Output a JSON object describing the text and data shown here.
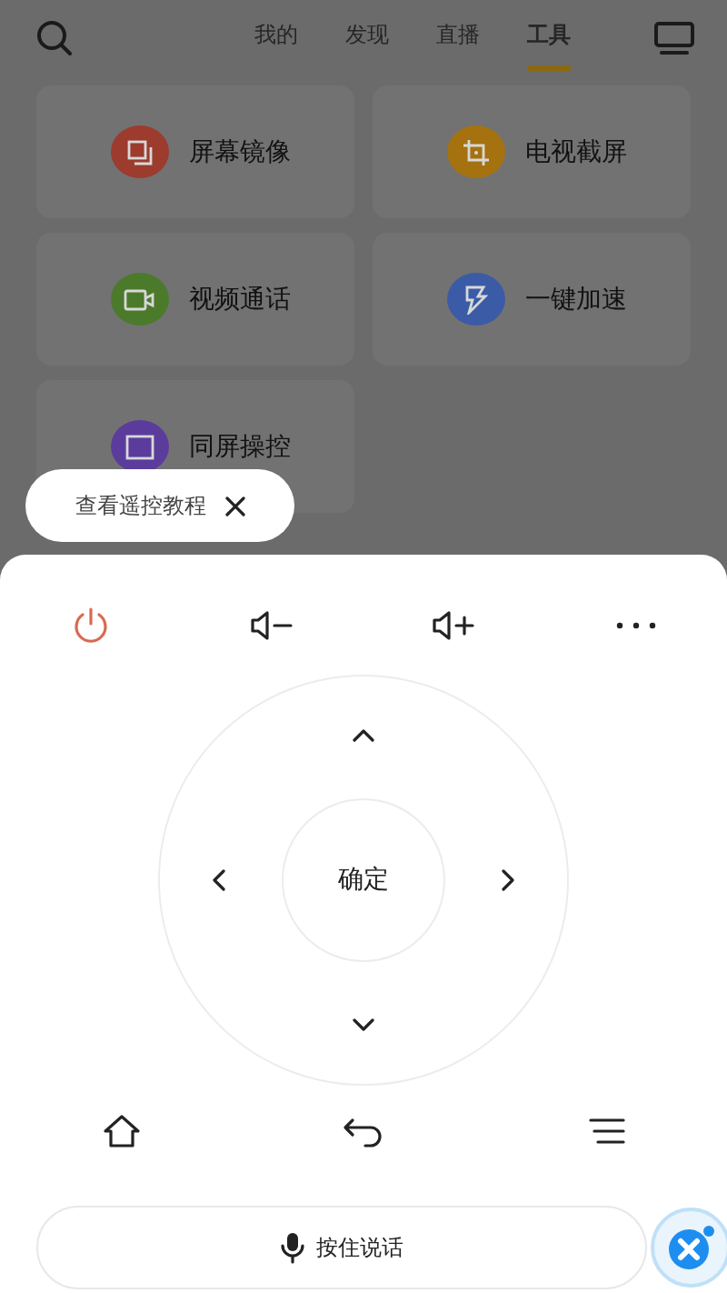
{
  "header": {
    "tabs": [
      {
        "label": "我的",
        "selected": false
      },
      {
        "label": "发现",
        "selected": false
      },
      {
        "label": "直播",
        "selected": false
      },
      {
        "label": "工具",
        "selected": true
      }
    ]
  },
  "tools": [
    {
      "label": "屏幕镜像",
      "color": "#9c3b2e",
      "kind": "mirror"
    },
    {
      "label": "电视截屏",
      "color": "#a5720f",
      "kind": "screenshot"
    },
    {
      "label": "视频通话",
      "color": "#4b7a2b",
      "kind": "video"
    },
    {
      "label": "一键加速",
      "color": "#3b5ba6",
      "kind": "boost"
    },
    {
      "label": "同屏操控",
      "color": "#5b3c9c",
      "kind": "cast"
    }
  ],
  "tooltip": {
    "text": "查看遥控教程"
  },
  "remote": {
    "center_label": "确定"
  },
  "voice_button": {
    "label": "按住说话"
  }
}
